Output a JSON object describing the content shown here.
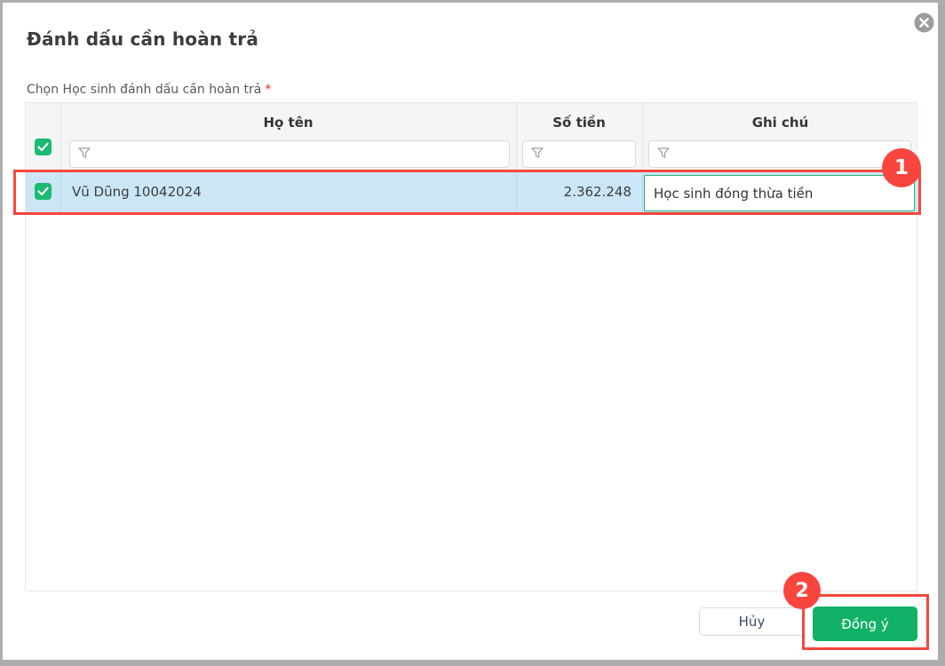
{
  "modal": {
    "title": "Đánh dấu cần hoàn trả",
    "field_label": "Chọn Học sinh đánh dấu cần hoàn trả",
    "required_mark": "*"
  },
  "table": {
    "header_checkbox_checked": true,
    "columns": [
      {
        "key": "name",
        "label": "Họ tên"
      },
      {
        "key": "amount",
        "label": "Số tiền"
      },
      {
        "key": "note",
        "label": "Ghi chú"
      }
    ],
    "filters": {
      "name": "",
      "amount": "",
      "note": ""
    },
    "rows": [
      {
        "selected": true,
        "name": "Vũ Dũng 10042024",
        "amount": "2.362.248",
        "note": "Học sinh đóng thừa tiền"
      }
    ]
  },
  "footer": {
    "cancel_label": "Hủy",
    "confirm_label": "Đồng ý"
  },
  "annotations": {
    "step1": "1",
    "step2": "2"
  },
  "colors": {
    "accent_green": "#11b168",
    "checkbox_green": "#1bba70",
    "selected_row_blue": "#cbe6f6",
    "annotation_red": "#f8463e"
  }
}
